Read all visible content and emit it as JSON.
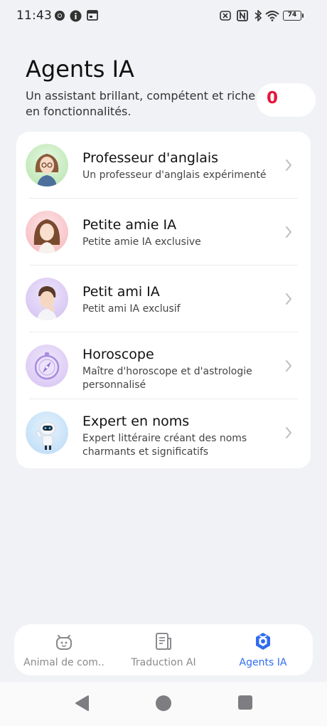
{
  "status_bar": {
    "time": "11:43",
    "battery": "74",
    "icons": [
      "chrome-icon",
      "info-icon",
      "calendar-icon",
      "nfc-off-icon",
      "nfc-icon",
      "bluetooth-icon",
      "wifi-icon",
      "battery-icon"
    ]
  },
  "header": {
    "title": "Agents IA",
    "subtitle": "Un assistant brillant, compétent et riche en fonctionnalités.",
    "counter": "0"
  },
  "agents": [
    {
      "title": "Professeur d'anglais",
      "desc": "Un professeur d'anglais expérimenté",
      "icon": "teacher-avatar"
    },
    {
      "title": "Petite amie IA",
      "desc": "Petite amie IA exclusive",
      "icon": "girlfriend-avatar"
    },
    {
      "title": "Petit ami IA",
      "desc": "Petit ami IA exclusif",
      "icon": "boyfriend-avatar"
    },
    {
      "title": "Horoscope",
      "desc": "Maître d'horoscope et d'astrologie personnalisé",
      "icon": "compass-avatar"
    },
    {
      "title": "Expert en noms",
      "desc": "Expert littéraire créant des noms charmants et significatifs",
      "icon": "robot-avatar"
    }
  ],
  "bottom_nav": {
    "tabs": [
      {
        "label": "Animal de com..",
        "icon": "pet-robot-icon",
        "active": false
      },
      {
        "label": "Traduction AI",
        "icon": "document-icon",
        "active": false
      },
      {
        "label": "Agents IA",
        "icon": "agents-icon",
        "active": true
      }
    ]
  },
  "colors": {
    "background": "#f1f2f5",
    "accent": "#2f6cf0",
    "counter": "#e8143a"
  }
}
